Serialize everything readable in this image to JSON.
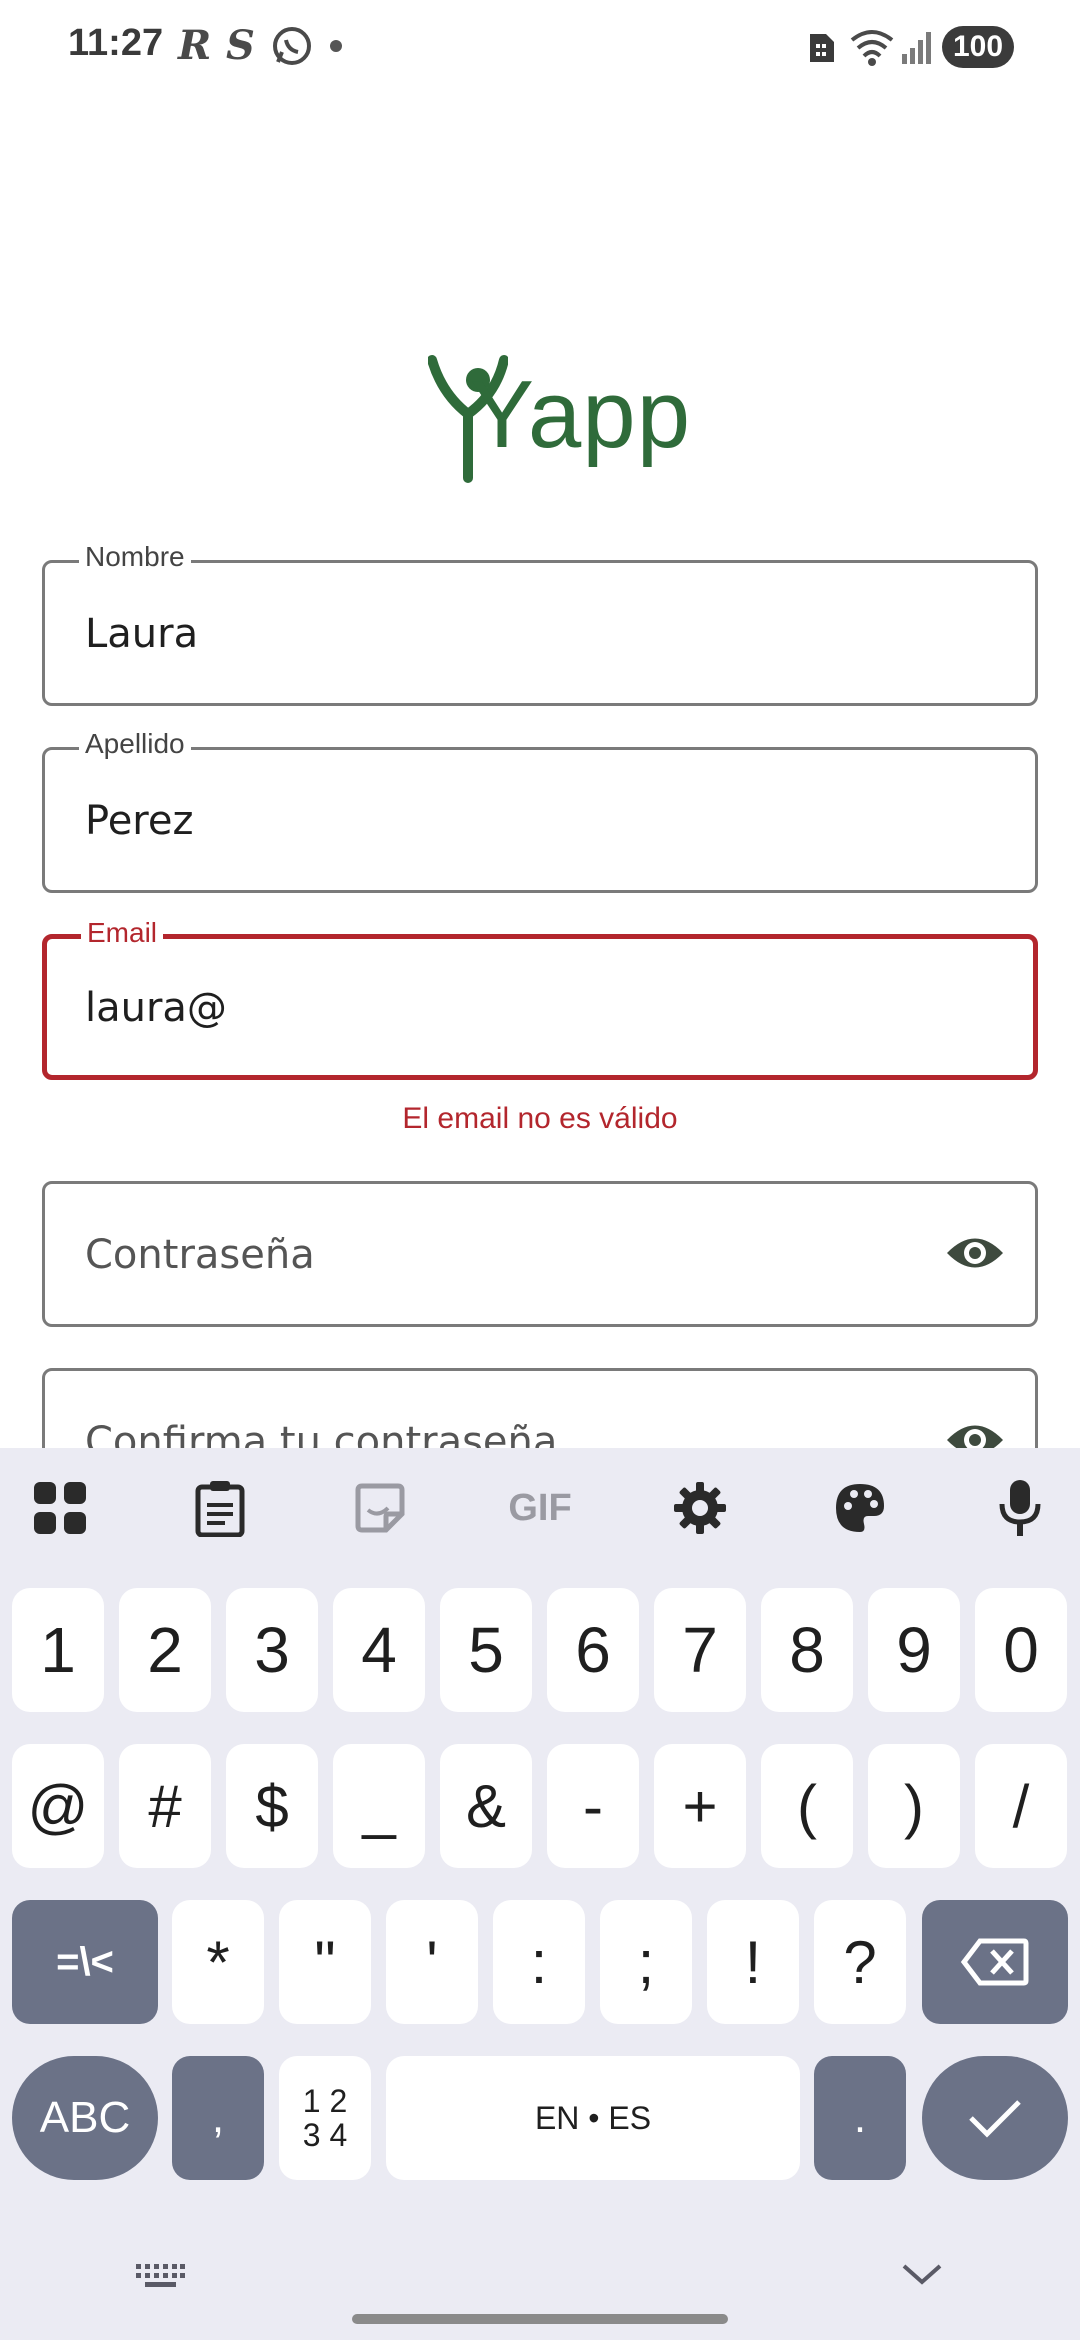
{
  "status_bar": {
    "time": "11:27",
    "app_icons": [
      "R",
      "S"
    ],
    "battery": "100"
  },
  "logo": {
    "text": "Yapp",
    "color": "#2f6b3a"
  },
  "form": {
    "nombre": {
      "label": "Nombre",
      "value": "Laura"
    },
    "apellido": {
      "label": "Apellido",
      "value": "Perez"
    },
    "email": {
      "label": "Email",
      "value": "laura@",
      "error": "El email no es válido"
    },
    "password": {
      "placeholder": "Contraseña"
    },
    "confirm_password": {
      "placeholder": "Confirma tu contraseña"
    }
  },
  "keyboard": {
    "toolbar_icons": [
      "apps-grid-icon",
      "clipboard-icon",
      "sticker-icon",
      "gif-icon",
      "settings-icon",
      "palette-icon",
      "microphone-icon"
    ],
    "gif_label": "GIF",
    "row1": [
      "1",
      "2",
      "3",
      "4",
      "5",
      "6",
      "7",
      "8",
      "9",
      "0"
    ],
    "row2": [
      "@",
      "#",
      "$",
      "_",
      "&",
      "-",
      "+",
      "(",
      ")",
      "/"
    ],
    "row3": [
      "*",
      "\"",
      "'",
      ":",
      ";",
      "!",
      "?"
    ],
    "row3_left": "=\\<",
    "row4": {
      "abc": "ABC",
      "comma": ",",
      "numpad_top": "1 2",
      "numpad_bottom": "3 4",
      "space": "EN • ES",
      "period": "."
    }
  },
  "colors": {
    "error": "#b3262d",
    "keyboard_bg": "#ebebf3",
    "dark_key": "#6b7287"
  }
}
